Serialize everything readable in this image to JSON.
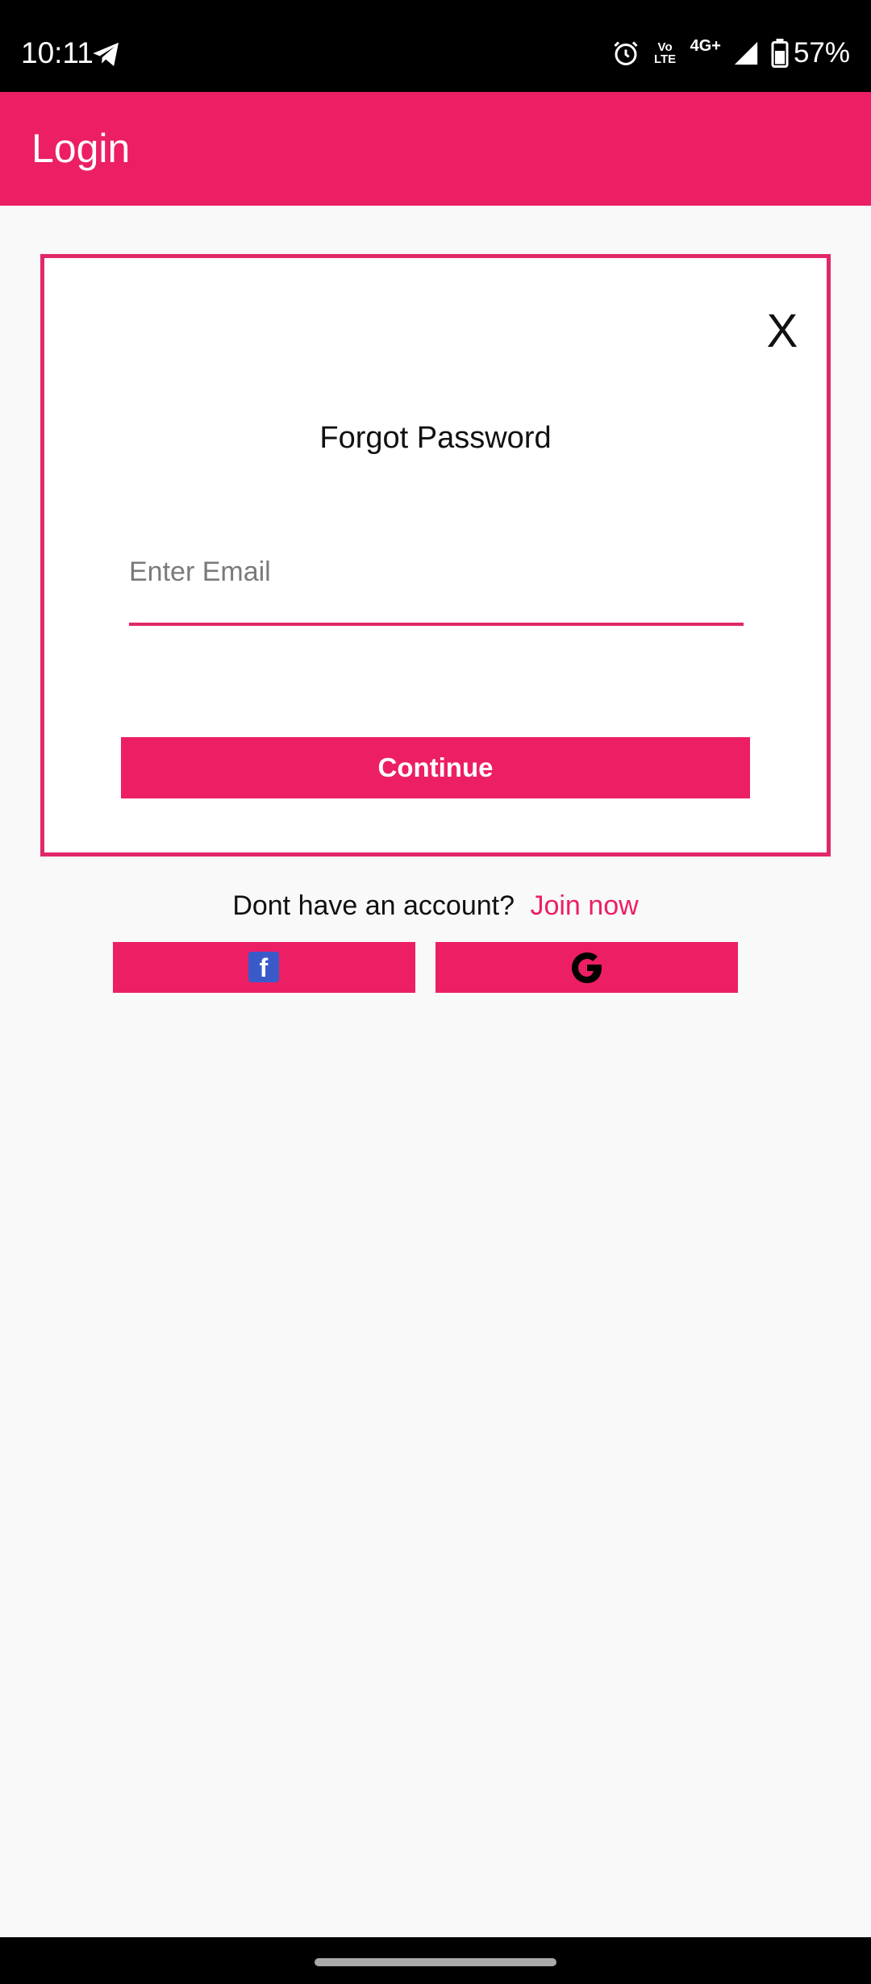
{
  "status_bar": {
    "time": "10:11",
    "volte_top": "Vo",
    "volte_bottom": "LTE",
    "network": "4G+",
    "battery": "57%",
    "icons": [
      "telegram-icon",
      "alarm-icon",
      "volte-icon",
      "signal-icon",
      "battery-icon"
    ]
  },
  "app_bar": {
    "title": "Login"
  },
  "dialog": {
    "close_label": "X",
    "title": "Forgot Password",
    "email_placeholder": "Enter Email",
    "email_value": "",
    "continue_label": "Continue"
  },
  "signup": {
    "prompt": "Dont have an account?",
    "link": "Join now"
  },
  "social": {
    "facebook_glyph": "f",
    "google_icon": "google-icon"
  },
  "colors": {
    "accent": "#ec1f64",
    "background": "#f9f9f9",
    "dialog_border": "#e0286a",
    "facebook_blue": "#3b5ac9"
  }
}
